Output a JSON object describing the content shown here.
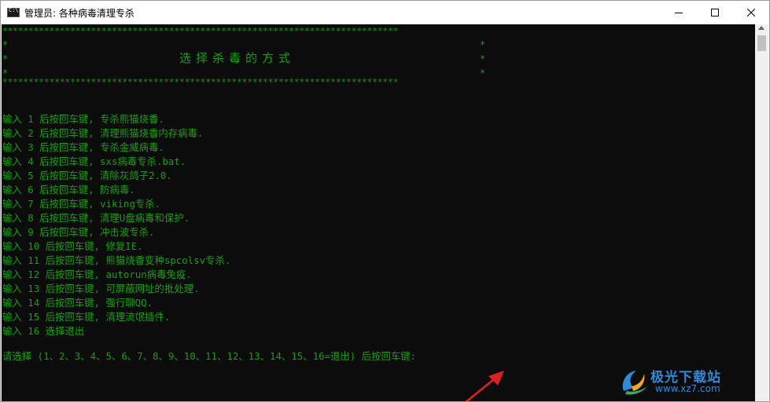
{
  "window": {
    "title": "管理员: 各种病毒清理专杀",
    "icon": "cmd-icon",
    "controls": [
      "minimize-icon",
      "maximize-icon",
      "close-icon"
    ]
  },
  "console": {
    "star_line": "****************************************************************************",
    "side_star": "*",
    "heading": "选择杀毒的方式",
    "menu": [
      "输入 1 后按回车键, 专杀熊猫烧香.",
      "输入 2 后按回车键, 清理熊猫烧香内存病毒.",
      "输入 3 后按回车键, 专杀金威病毒.",
      "输入 4 后按回车键, sxs病毒专杀.bat.",
      "输入 5 后按回车键, 清除灰鸽子2.0.",
      "输入 6 后按回车键, 防病毒.",
      "输入 7 后按回车键, viking专杀.",
      "输入 8 后按回车键, 清理U盘病毒和保护.",
      "输入 9 后按回车键, 冲击波专杀.",
      "输入 10 后按回车键, 修复IE.",
      "输入 11 后按回车键, 熊猫烧香变种spcolsv专杀.",
      "输入 12 后按回车键, autorun病毒免疫.",
      "输入 13 后按回车键, 可屏蔽网址的批处理.",
      "输入 14 后按回车键, 强行聊QQ.",
      "输入 15 后按回车键, 清理流氓插件.",
      "输入 16 选择退出"
    ],
    "prompt": "请选择 (1、2、3、4、5、6、7、8、9、10、11、12、13、14、15、16=退出) 后按回车键:"
  },
  "watermark": {
    "name": "极光下载站",
    "url": "www.xz7.com"
  },
  "colors": {
    "console_bg": "#0c0c0c",
    "console_text": "#13a10e",
    "arrow": "#e02020",
    "watermark": "#2e8ad8"
  }
}
